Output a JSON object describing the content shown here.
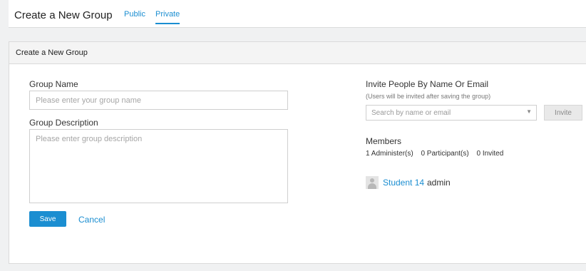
{
  "header": {
    "title": "Create a New Group",
    "tabs": [
      {
        "label": "Public"
      },
      {
        "label": "Private",
        "active": true
      }
    ]
  },
  "form": {
    "section_title": "Create a New Group",
    "group_name_label": "Group Name",
    "group_name_placeholder": "Please enter your group name",
    "group_name_value": "",
    "description_label": "Group Description",
    "description_placeholder": "Please enter group description",
    "description_value": "",
    "save_label": "Save",
    "cancel_label": "Cancel"
  },
  "invite": {
    "title": "Invite People By Name Or Email",
    "subtitle": "(Users will be invited after saving the group)",
    "search_placeholder": "Search by name or email",
    "invite_label": "Invite"
  },
  "members": {
    "title": "Members",
    "counts": {
      "administers": "1 Administer(s)",
      "participants": "0 Participant(s)",
      "invited": "0 Invited"
    },
    "list": [
      {
        "name": "Student 14",
        "role": "admin",
        "icon": "user-avatar-icon"
      }
    ]
  },
  "colors": {
    "accent": "#1b8ed1",
    "background": "#f0f1f2"
  }
}
